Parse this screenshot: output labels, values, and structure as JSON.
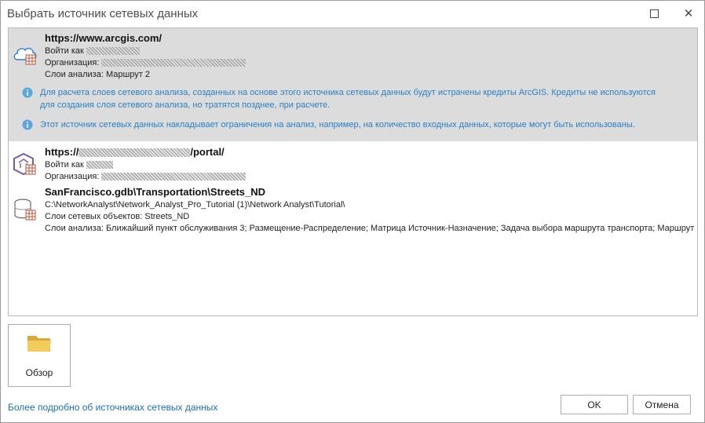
{
  "window": {
    "title": "Выбрать источник сетевых данных",
    "close_glyph": "✕"
  },
  "sources": [
    {
      "url": "https://www.arcgis.com/",
      "login_label": "Войти как",
      "org_label": "Организация:",
      "layers_label": "Слои анализа: Маршрут 2",
      "icon": "cloud-network-icon",
      "notes": [
        "Для расчета слоев сетевого анализа, созданных на основе этого источника сетевых данных будут истрачены кредиты ArcGIS. Кредиты не используются для создания слоя сетевого анализа, но тратятся позднее, при расчете.",
        "Этот источник сетевых данных накладывает ограничения на анализ, например, на количество входных данных, которые могут быть использованы."
      ]
    },
    {
      "url_prefix": "https://",
      "url_suffix": "/portal/",
      "login_label": "Войти как",
      "org_label": "Организация:",
      "icon": "portal-network-icon"
    },
    {
      "title": "SanFrancisco.gdb\\Transportation\\Streets_ND",
      "path": "C:\\NetworkAnalyst\\Network_Analyst_Pro_Tutorial (1)\\Network Analyst\\Tutorial\\",
      "feature_layers": "Слои сетевых объектов: Streets_ND",
      "analysis_layers": "Слои анализа: Ближайший пункт обслуживания 3; Размещение-Распределение; Матрица Источник-Назначение; Задача выбора маршрута транспорта; Маршрут",
      "icon": "database-network-icon"
    }
  ],
  "browse": {
    "label": "Обзор",
    "icon": "folder-icon"
  },
  "footer": {
    "link": "Более подробно об источниках сетевых данных",
    "ok": "OK",
    "cancel": "Отмена"
  },
  "colors": {
    "accent": "#2a7fc4",
    "selection": "#dcdcdc",
    "folder": "#e8c24a"
  }
}
